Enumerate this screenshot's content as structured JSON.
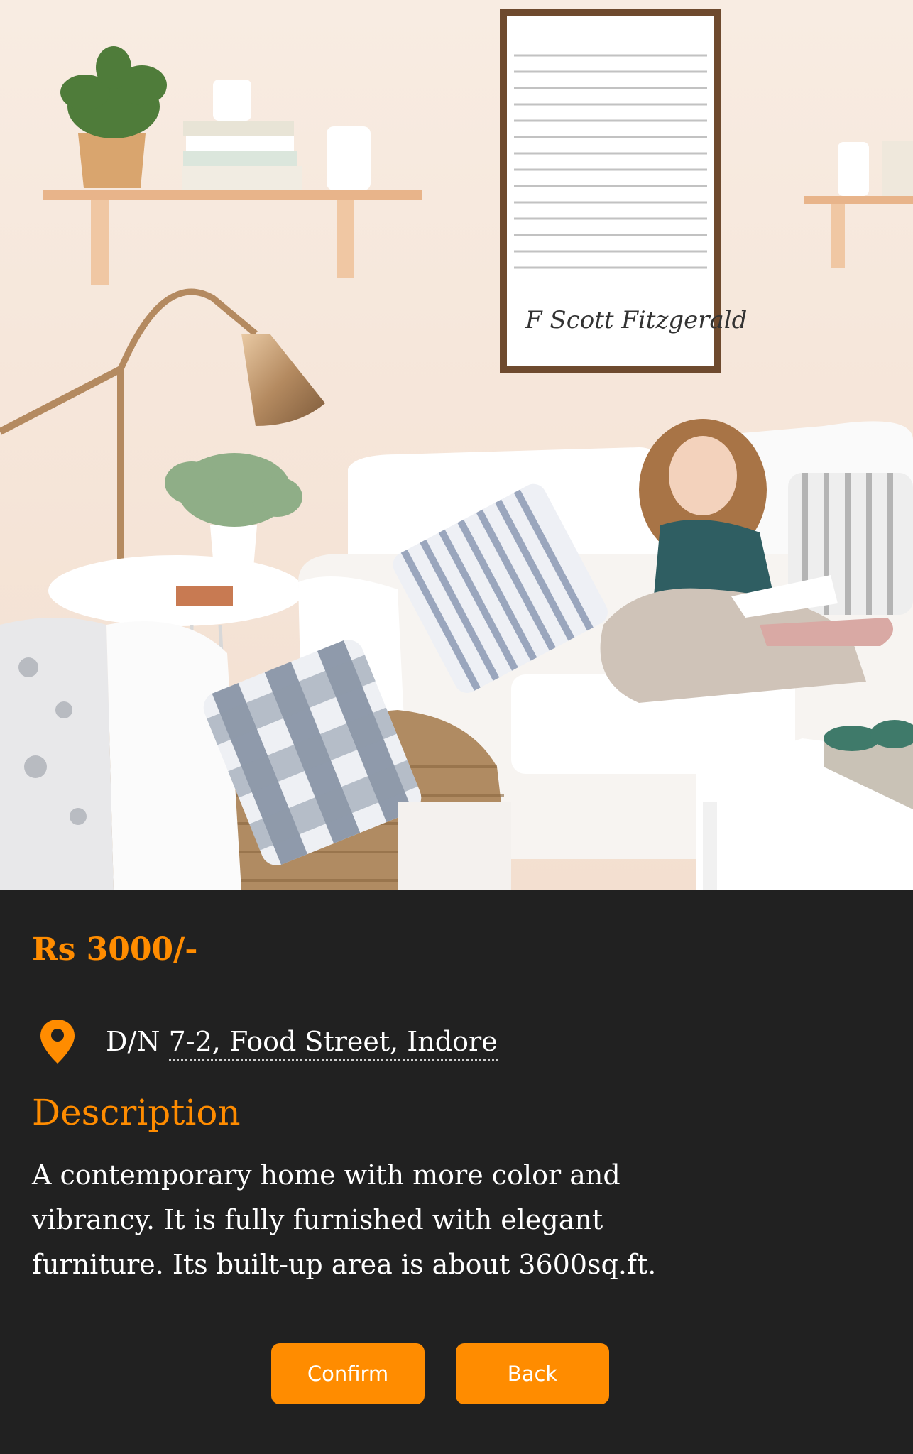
{
  "listing": {
    "image_alt": "Living room with white sofa, girl reading a book, floor lamp and wall shelves",
    "price": "Rs 3000/-",
    "address_prefix": "D/N ",
    "address_rest": "7-2, Food Street, Indore",
    "description_heading": "Description",
    "description": "A contemporary home with more color and vibrancy. It is fully furnished with elegant furniture. Its built-up area is about 3600sq.ft.",
    "poster_signature": "F Scott Fitzgerald"
  },
  "actions": {
    "confirm_label": "Confirm",
    "back_label": "Back"
  },
  "icons": {
    "location": "map-pin-icon"
  },
  "colors": {
    "background": "#212121",
    "accent": "#ff8c00",
    "text": "#ffffff"
  }
}
